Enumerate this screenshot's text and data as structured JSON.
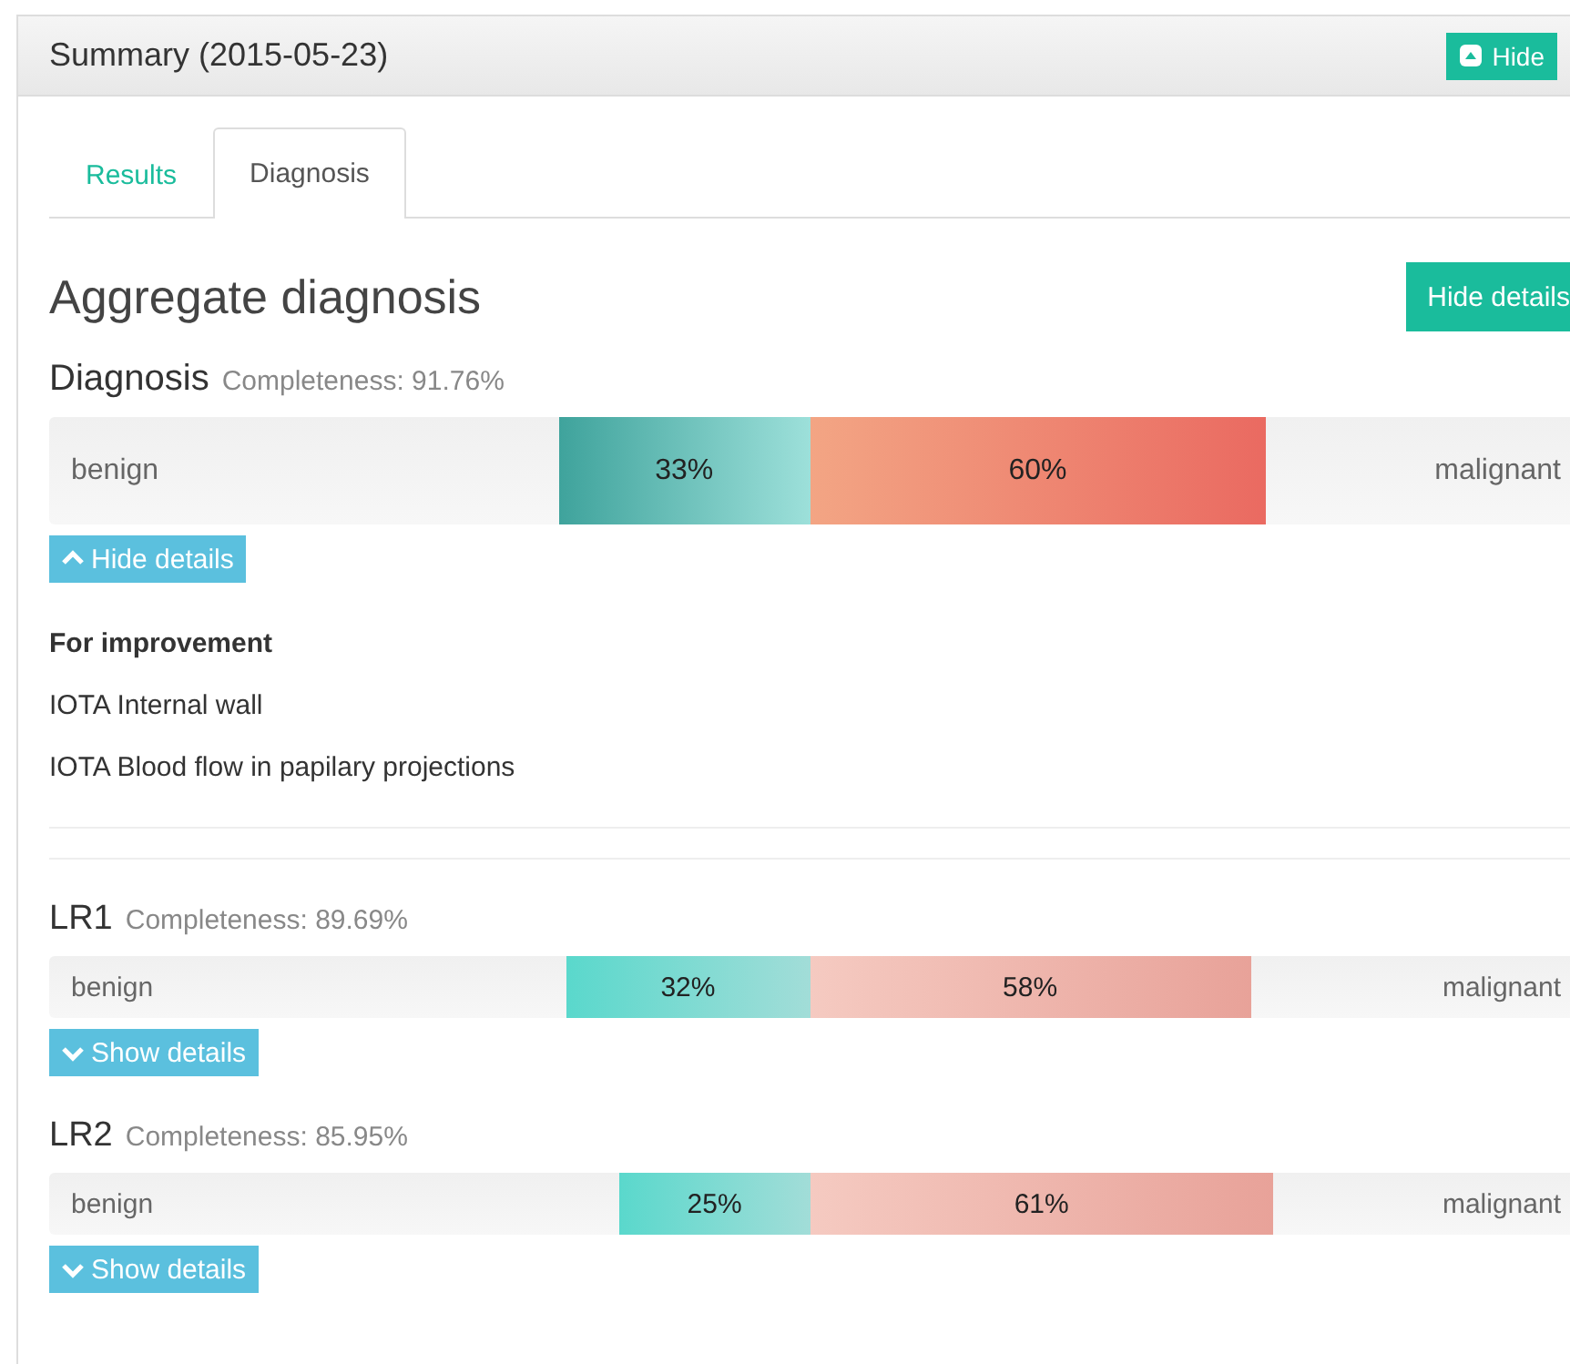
{
  "panel": {
    "title": "Summary (2015-05-23)",
    "hide_button": "Hide"
  },
  "tabs": [
    {
      "label": "Results",
      "selected": false
    },
    {
      "label": "Diagnosis",
      "selected": true
    }
  ],
  "heading": "Aggregate diagnosis",
  "hide_details_button": "Hide details",
  "models": [
    {
      "kind": "aggregate",
      "name": "Diagnosis",
      "completeness": "Completeness: 91.76%",
      "left_label": "benign",
      "right_label": "malignant",
      "benign": {
        "level": 0.33,
        "reading": "33%"
      },
      "malignant": {
        "level": 0.6,
        "reading": "60%"
      },
      "details_button": "Hide details",
      "expanded": true,
      "improvement_title": "For improvement",
      "improvements": [
        "IOTA Internal wall",
        "IOTA Blood flow in papilary projections"
      ]
    },
    {
      "kind": "model",
      "name": "LR1",
      "completeness": "Completeness: 89.69%",
      "left_label": "benign",
      "right_label": "malignant",
      "benign": {
        "level": 0.32,
        "reading": "32%"
      },
      "malignant": {
        "level": 0.58,
        "reading": "58%"
      },
      "details_button": "Show details",
      "expanded": false
    },
    {
      "kind": "model",
      "name": "LR2",
      "completeness": "Completeness: 85.95%",
      "left_label": "benign",
      "right_label": "malignant",
      "benign": {
        "level": 0.25,
        "reading": "25%"
      },
      "malignant": {
        "level": 0.61,
        "reading": "61%"
      },
      "details_button": "Show details",
      "expanded": false
    }
  ]
}
